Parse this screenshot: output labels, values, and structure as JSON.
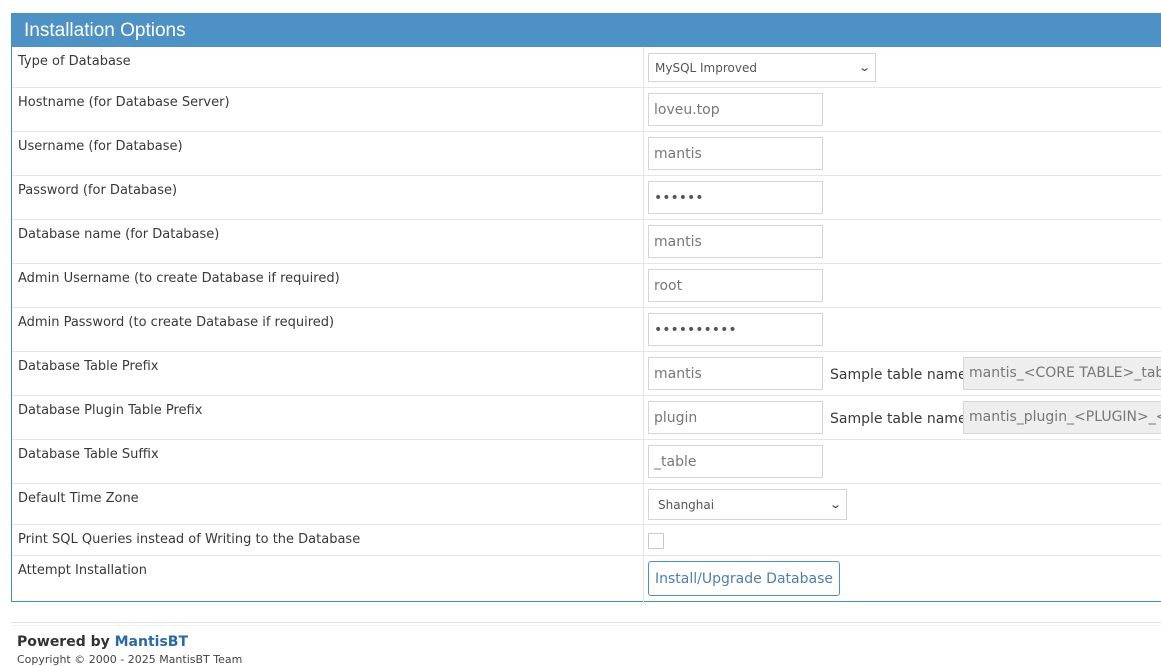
{
  "header": {
    "title": "Installation Options"
  },
  "rows": {
    "db_type": {
      "label": "Type of Database",
      "value": "MySQL Improved"
    },
    "hostname": {
      "label": "Hostname (for Database Server)",
      "value": "loveu.top"
    },
    "username": {
      "label": "Username (for Database)",
      "value": "mantis"
    },
    "password": {
      "label": "Password (for Database)",
      "value": "••••••"
    },
    "db_name": {
      "label": "Database name (for Database)",
      "value": "mantis"
    },
    "admin_username": {
      "label": "Admin Username (to create Database if required)",
      "value": "root"
    },
    "admin_password": {
      "label": "Admin Password (to create Database if required)",
      "value": "••••••••••"
    },
    "table_prefix": {
      "label": "Database Table Prefix",
      "value": "mantis",
      "sample_label": "Sample table name:",
      "sample_value": "mantis_<CORE TABLE>_table"
    },
    "plugin_prefix": {
      "label": "Database Plugin Table Prefix",
      "value": "plugin",
      "sample_label": "Sample table name:",
      "sample_value": "mantis_plugin_<PLUGIN>_<TA"
    },
    "table_suffix": {
      "label": "Database Table Suffix",
      "value": "_table"
    },
    "timezone": {
      "label": "Default Time Zone",
      "value": "Shanghai"
    },
    "print_sql": {
      "label": "Print SQL Queries instead of Writing to the Database",
      "checked": false
    },
    "attempt": {
      "label": "Attempt Installation",
      "button": "Install/Upgrade Database"
    }
  },
  "footer": {
    "powered_prefix": "Powered by ",
    "powered_link": "MantisBT",
    "copyright": "Copyright © 2000 - 2025 MantisBT Team"
  },
  "colors": {
    "header_bg": "#4e91c4",
    "link": "#2a6aa8"
  }
}
